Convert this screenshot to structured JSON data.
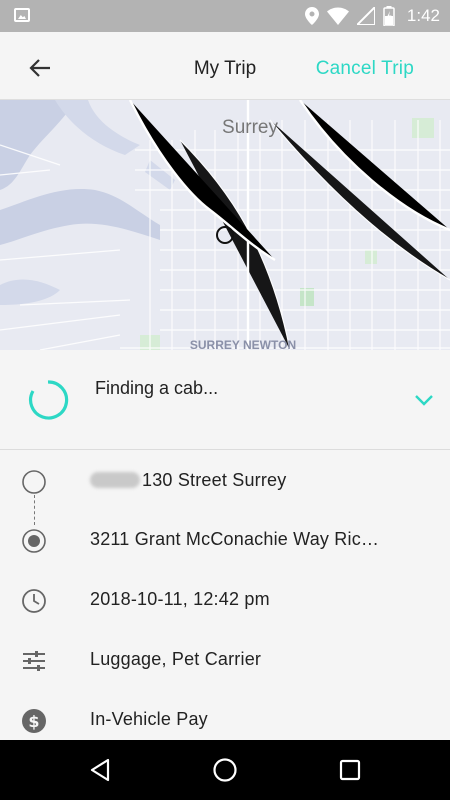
{
  "status_bar": {
    "time": "1:42",
    "icons": [
      "image-icon",
      "location-icon",
      "wifi-icon",
      "signal-icon",
      "battery-icon"
    ]
  },
  "header": {
    "title": "My Trip",
    "cancel_label": "Cancel Trip",
    "back_icon": "arrow-back-icon"
  },
  "map": {
    "city_label": "Surrey",
    "area_label": "SURREY NEWTON"
  },
  "status_panel": {
    "text": "Finding a cab...",
    "expand_icon": "chevron-down-icon"
  },
  "trip": {
    "pickup": {
      "text": "130 Street Surrey",
      "icon": "pickup-circle-icon"
    },
    "dropoff": {
      "text": "3211 Grant McConachie Way Ric…",
      "icon": "dropoff-radio-icon"
    },
    "time": {
      "text": "2018-10-11, 12:42 pm",
      "icon": "clock-icon"
    },
    "options": {
      "text": "Luggage, Pet Carrier",
      "icon": "sliders-icon"
    },
    "payment": {
      "text": "In-Vehicle Pay",
      "icon": "dollar-icon"
    }
  },
  "colors": {
    "accent": "#2dd8c5",
    "status_bar": "#b3b3b3",
    "nav_bar": "#000000"
  }
}
